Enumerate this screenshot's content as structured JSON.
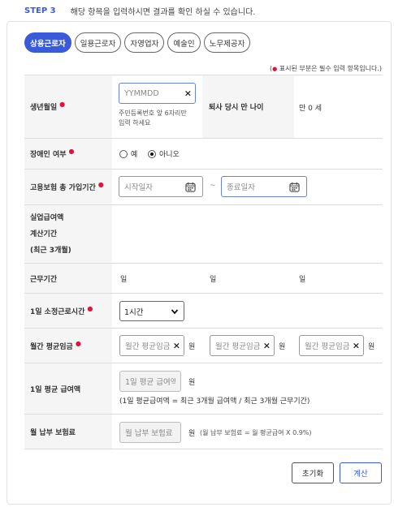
{
  "header": {
    "step_label": "STEP 3",
    "description": "해당 항목을 입력하시면 결과를 확인 하실 수 있습니다."
  },
  "tabs": [
    {
      "label": "상용근로자",
      "active": true
    },
    {
      "label": "일용근로자",
      "active": false
    },
    {
      "label": "자영업자",
      "active": false
    },
    {
      "label": "예술인",
      "active": false
    },
    {
      "label": "노무제공자",
      "active": false
    }
  ],
  "required_note": {
    "prefix": "(",
    "dot": "●",
    "text": " 표시된 부분은 필수 입력 항목입니다.)"
  },
  "form": {
    "birth": {
      "label": "생년월일",
      "placeholder": "YYMMDD",
      "help": "주민등록번호 앞 6자리만\n입력 하세요",
      "age_label": "퇴사 당시 만 나이",
      "age_value": "만 0 세"
    },
    "disability": {
      "label": "장애인 여부",
      "options": [
        {
          "label": "예",
          "selected": false
        },
        {
          "label": "아니오",
          "selected": true
        }
      ]
    },
    "insurance_period": {
      "label": "고용보험 총 가입기간",
      "start_placeholder": "시작일자",
      "separator": "~",
      "end_placeholder": "종료일자"
    },
    "calc_period": {
      "label_lines": [
        "실업급여액",
        "계산기간",
        "(최근 3개월)"
      ]
    },
    "work_days": {
      "label": "근무기간",
      "units": [
        "일",
        "일",
        "일"
      ]
    },
    "daily_hours": {
      "label": "1일 소정근로시간",
      "selected": "1시간"
    },
    "monthly_wage": {
      "label": "월간 평균임금",
      "placeholder": "월간 평균임금",
      "unit": "원"
    },
    "daily_avg_wage": {
      "label": "1일 평균 급여액",
      "placeholder": "1일 평균 급여액",
      "unit": "원",
      "formula": "(1일 평균급여액 = 최근 3개월 급여액 / 최근 3개월 근무기간)"
    },
    "premium": {
      "label": "월 납부 보험료",
      "placeholder": "월 납부 보험료",
      "unit": "원",
      "formula": "(월 납부 보험료 = 월 평균급여 X 0.9%)"
    }
  },
  "buttons": {
    "reset": "초기화",
    "calculate": "계산"
  },
  "colors": {
    "accent": "#3a5bd9",
    "required_dot": "#e0133e"
  },
  "icons": {
    "clear": "×",
    "calendar": "calendar-icon",
    "chevron": "chevron-down-icon"
  }
}
